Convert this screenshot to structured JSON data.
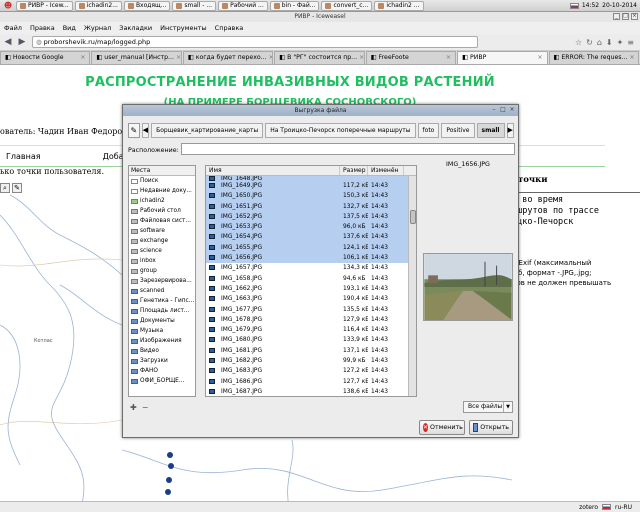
{
  "taskbar": {
    "start_label": "☻",
    "items": [
      "РИВР - Icew...",
      "ichadin2...",
      "Входящ...",
      "small - ...",
      "Рабочий ...",
      "bin - Фай...",
      "convert_c...",
      "ichadin2 ..."
    ],
    "time": "14:52",
    "date": "20-10-2014"
  },
  "window": {
    "title": "РИВР - Iceweasel"
  },
  "menubar": [
    "Файл",
    "Правка",
    "Вид",
    "Журнал",
    "Закладки",
    "Инструменты",
    "Справка"
  ],
  "navbar": {
    "url": "proborshevik.ru/map/logged.php"
  },
  "tabs": [
    "Новости Google",
    "user_manual [Инстр...",
    "когда будет перехо...",
    "В \"РГ\" состоится пр...",
    "FreeFoote",
    "РИВР",
    "ERROR: The reques..."
  ],
  "page": {
    "headline": "РАСПРОСТРАНЕНИЕ ИНВАЗИВНЫХ ВИДОВ РАСТЕНИЙ",
    "subheadline": "(НА ПРИМЕРЕ БОРЩЕВИКА СОСНОВСКОГО)",
    "user_line": "ователь: Чадин Иван Федоро",
    "menu": [
      "Главная",
      "Добавлен"
    ],
    "points_line": "ько точки пользователя.",
    "map_label": "Котлас",
    "right_heading": "точки",
    "right_lines": [
      "ю во время",
      "ршрутов по трассе",
      "ицко-Печорск"
    ],
    "right_info": [
      "а Exif (максимальный",
      "Мб, формат -.JPG,.jpg;",
      "лов не должен превышать"
    ],
    "status": [
      "zotero",
      "ru-RU"
    ]
  },
  "dialog": {
    "title": "Выгрузка файла",
    "crumbs": [
      "Борщевик_картирование_карты",
      "На Троицко-Печорск поперечные маршруты",
      "foto",
      "Positive",
      "small"
    ],
    "location_label": "Расположение:",
    "location_value": "",
    "places_header": "Места",
    "places": [
      {
        "label": "Поиск",
        "icon": "doc"
      },
      {
        "label": "Недавние доку...",
        "icon": "doc"
      },
      {
        "label": "ichadin2",
        "icon": "home"
      },
      {
        "label": "Рабочий стол",
        "icon": "gray"
      },
      {
        "label": "Файловая сист...",
        "icon": "gray"
      },
      {
        "label": "software",
        "icon": "gray"
      },
      {
        "label": "exchange",
        "icon": "gray"
      },
      {
        "label": "science",
        "icon": "gray"
      },
      {
        "label": "inbox",
        "icon": "gray"
      },
      {
        "label": "group",
        "icon": "gray"
      },
      {
        "label": "Зарезервирова...",
        "icon": "gray"
      },
      {
        "label": "scanned",
        "icon": "folder"
      },
      {
        "label": "Генетика - Гипс...",
        "icon": "folder"
      },
      {
        "label": "Площадь лист...",
        "icon": "folder"
      },
      {
        "label": "Документы",
        "icon": "folder"
      },
      {
        "label": "Музыка",
        "icon": "folder"
      },
      {
        "label": "Изображения",
        "icon": "folder"
      },
      {
        "label": "Видео",
        "icon": "folder"
      },
      {
        "label": "Загрузки",
        "icon": "folder"
      },
      {
        "label": "ФАНО",
        "icon": "folder"
      },
      {
        "label": "ОФИ_БОРЩЕ...",
        "icon": "folder"
      }
    ],
    "columns": [
      "Имя",
      "Размер",
      "Изменён"
    ],
    "files": [
      {
        "name": "IMG_1648.JPG",
        "size": "",
        "time": "",
        "sel": true
      },
      {
        "name": "IMG_1649.JPG",
        "size": "117,2 кБ",
        "time": "14:43",
        "sel": true
      },
      {
        "name": "IMG_1650.JPG",
        "size": "150,3 кБ",
        "time": "14:43",
        "sel": true
      },
      {
        "name": "IMG_1651.JPG",
        "size": "132,7 кБ",
        "time": "14:43",
        "sel": true
      },
      {
        "name": "IMG_1652.JPG",
        "size": "137,5 кБ",
        "time": "14:43",
        "sel": true
      },
      {
        "name": "IMG_1653.JPG",
        "size": "96,0 кБ",
        "time": "14:43",
        "sel": true
      },
      {
        "name": "IMG_1654.JPG",
        "size": "137,6 кБ",
        "time": "14:43",
        "sel": true
      },
      {
        "name": "IMG_1655.JPG",
        "size": "124,1 кБ",
        "time": "14:43",
        "sel": true
      },
      {
        "name": "IMG_1656.JPG",
        "size": "106,1 кБ",
        "time": "14:43",
        "sel": true
      },
      {
        "name": "IMG_1657.JPG",
        "size": "134,3 кБ",
        "time": "14:43",
        "sel": false
      },
      {
        "name": "IMG_1658.JPG",
        "size": "94,6 кБ",
        "time": "14:43",
        "sel": false
      },
      {
        "name": "IMG_1662.JPG",
        "size": "193,1 кБ",
        "time": "14:43",
        "sel": false
      },
      {
        "name": "IMG_1663.JPG",
        "size": "190,4 кБ",
        "time": "14:43",
        "sel": false
      },
      {
        "name": "IMG_1677.JPG",
        "size": "135,5 кБ",
        "time": "14:43",
        "sel": false
      },
      {
        "name": "IMG_1678.JPG",
        "size": "127,9 кБ",
        "time": "14:43",
        "sel": false
      },
      {
        "name": "IMG_1679.JPG",
        "size": "116,4 кБ",
        "time": "14:43",
        "sel": false
      },
      {
        "name": "IMG_1680.JPG",
        "size": "133,9 кБ",
        "time": "14:43",
        "sel": false
      },
      {
        "name": "IMG_1681.JPG",
        "size": "137,1 кБ",
        "time": "14:43",
        "sel": false
      },
      {
        "name": "IMG_1682.JPG",
        "size": "99,9 кБ",
        "time": "14:43",
        "sel": false
      },
      {
        "name": "IMG_1683.JPG",
        "size": "127,2 кБ",
        "time": "14:43",
        "sel": false
      },
      {
        "name": "IMG_1686.JPG",
        "size": "127,7 кБ",
        "time": "14:43",
        "sel": false
      },
      {
        "name": "IMG_1687.JPG",
        "size": "138,6 кБ",
        "time": "14:43",
        "sel": false
      }
    ],
    "preview_name": "IMG_1656.JPG",
    "filter": "Все файлы",
    "cancel_label": "Отменить",
    "open_label": "Открыть"
  }
}
